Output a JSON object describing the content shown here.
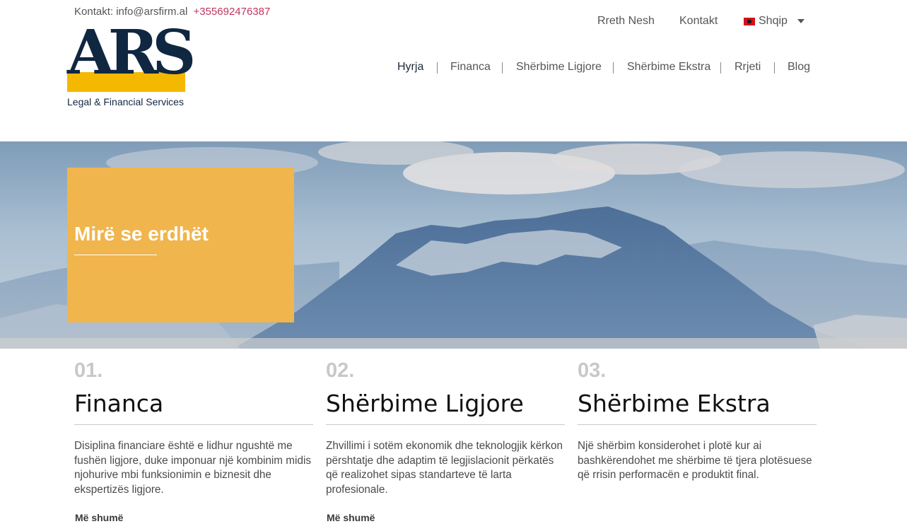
{
  "header": {
    "contact_label": "Kontakt: info@arsfirm.al",
    "phone": "+355692476387",
    "logo": {
      "letters": "ARS",
      "tagline": "Legal & Financial Services"
    },
    "top_links": {
      "about": "Rreth Nesh",
      "contact": "Kontakt",
      "language": "Shqip"
    },
    "nav": [
      "Hyrja",
      "Financa",
      "Shërbime Ligjore",
      "Shërbime Ekstra",
      "Rrjeti",
      "Blog"
    ],
    "active_nav": "Hyrja"
  },
  "hero": {
    "title": "Mirë se erdhët"
  },
  "services": [
    {
      "number": "01.",
      "title": "Financa",
      "text": "Disiplina financiare është e lidhur ngushtë me fushën ligjore, duke imponuar një kombinim midis njohurive mbi funksionimin e biznesit dhe ekspertizës ligjore.",
      "more": "Më shumë"
    },
    {
      "number": "02.",
      "title": "Shërbime Ligjore",
      "text": "Zhvillimi i sotëm ekonomik dhe teknologjik kërkon përshtatje dhe adaptim të legjislacionit përkatës që realizohet sipas standarteve të larta profesionale.",
      "more": "Më shumë"
    },
    {
      "number": "03.",
      "title": "Shërbime Ekstra",
      "text": "Një shërbim konsiderohet i plotë kur ai bashkërendohet me shërbime të tjera plotësuese që rrisin performacën e produktit final.",
      "more": ""
    }
  ],
  "colors": {
    "brand_navy": "#102742",
    "brand_yellow": "#f5b800",
    "hero_box": "#f0b54d",
    "phone": "#c0365f"
  }
}
